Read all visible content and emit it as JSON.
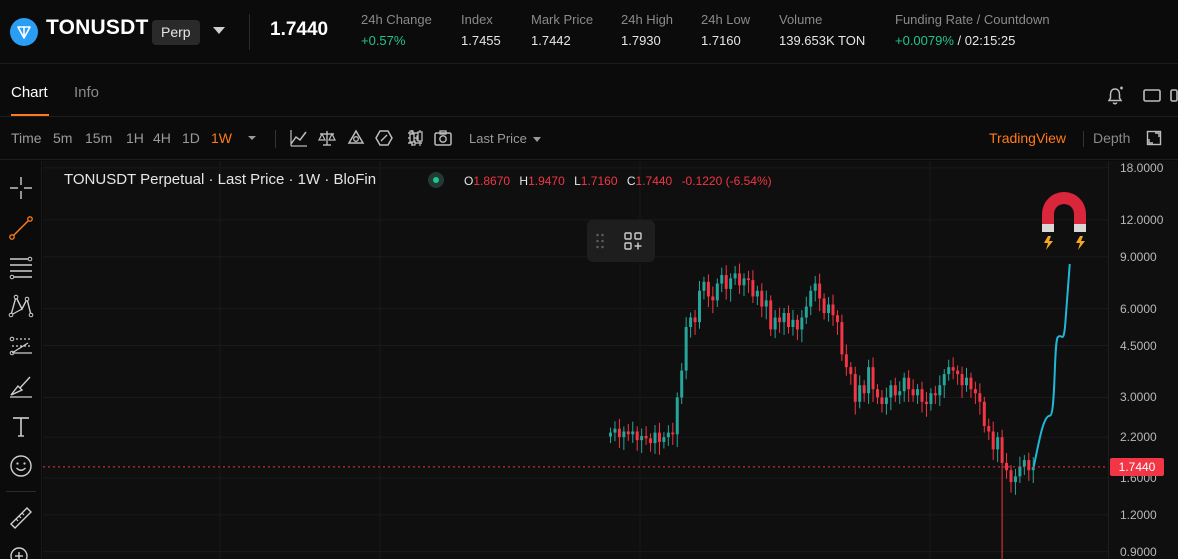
{
  "ticker": {
    "symbol": "TONUSDT",
    "badge": "Perp",
    "last_price": "1.7440",
    "stats": [
      {
        "label": "24h Change",
        "value": "+0.57%",
        "positive": true
      },
      {
        "label": "Index",
        "value": "1.7455"
      },
      {
        "label": "Mark Price",
        "value": "1.7442"
      },
      {
        "label": "24h High",
        "value": "1.7930"
      },
      {
        "label": "24h Low",
        "value": "1.7160"
      },
      {
        "label": "Volume",
        "value": "139.653K TON"
      }
    ],
    "funding": {
      "label": "Funding Rate / Countdown",
      "rate": "+0.0079%",
      "countdown": "/ 02:15:25"
    }
  },
  "tabs": {
    "chart": "Chart",
    "info": "Info"
  },
  "toolbar": {
    "timeframes": [
      "Time",
      "5m",
      "15m",
      "1H",
      "4H",
      "1D",
      "1W"
    ],
    "active_timeframe": "1W",
    "price_type": "Last Price",
    "tradingview": "TradingView",
    "depth": "Depth"
  },
  "legend": {
    "title": "TONUSDT Perpetual · Last Price · 1W · BloFin",
    "o_key": "O",
    "o": "1.8670",
    "h_key": "H",
    "h": "1.9470",
    "l_key": "L",
    "l": "1.7160",
    "c_key": "C",
    "c": "1.7440",
    "change": "-0.1220 (-6.54%)"
  },
  "axis": {
    "labels": [
      "18.0000",
      "12.0000",
      "9.0000",
      "6.0000",
      "4.5000",
      "3.0000",
      "2.2000",
      "1.6000",
      "1.2000",
      "0.9000"
    ],
    "current_tag": "1.7440"
  },
  "colors": {
    "up": "#26a69a",
    "down": "#f23645",
    "accent": "#ff7a1a",
    "projection": "#1fb8d6"
  },
  "chart_data": {
    "type": "candlestick",
    "scale": "log",
    "ylim": [
      0.85,
      19
    ],
    "interval": "1W",
    "last_close": 1.744,
    "closes": [
      2.28,
      2.35,
      2.2,
      2.3,
      2.25,
      2.3,
      2.15,
      2.22,
      2.18,
      2.1,
      2.28,
      2.12,
      2.2,
      2.28,
      2.25,
      3.0,
      3.7,
      5.2,
      5.6,
      5.4,
      6.9,
      7.4,
      6.6,
      6.4,
      7.3,
      7.8,
      7.0,
      7.6,
      7.9,
      7.2,
      7.6,
      7.5,
      6.6,
      6.9,
      6.1,
      6.4,
      5.1,
      5.6,
      5.4,
      5.8,
      5.2,
      5.5,
      5.1,
      5.6,
      6.1,
      6.9,
      7.3,
      6.5,
      5.8,
      6.2,
      5.7,
      5.4,
      4.2,
      3.8,
      3.6,
      2.9,
      3.3,
      3.1,
      3.8,
      3.2,
      3.0,
      2.85,
      3.0,
      3.3,
      3.05,
      3.15,
      3.5,
      3.2,
      3.05,
      3.2,
      2.9,
      2.85,
      3.1,
      3.05,
      3.3,
      3.6,
      3.8,
      3.7,
      3.6,
      3.3,
      3.5,
      3.2,
      3.1,
      2.9,
      2.4,
      2.3,
      2.0,
      2.2,
      1.8,
      1.7,
      1.55,
      1.62,
      1.75,
      1.84,
      1.7,
      1.744
    ],
    "projection": {
      "to": 8.5
    }
  }
}
